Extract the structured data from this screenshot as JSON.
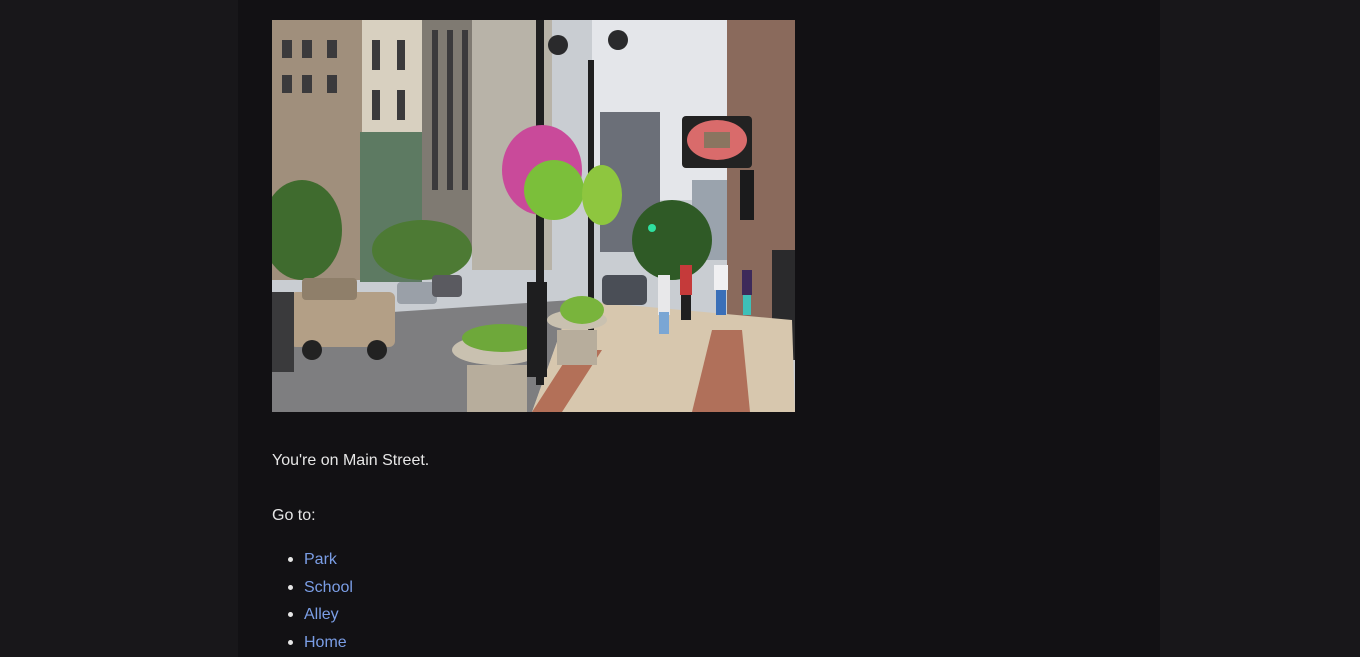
{
  "scene": {
    "description_text": "You're on Main Street.",
    "goto_label": "Go to:"
  },
  "links": [
    {
      "label": "Park"
    },
    {
      "label": "School"
    },
    {
      "label": "Alley"
    },
    {
      "label": "Home"
    }
  ]
}
